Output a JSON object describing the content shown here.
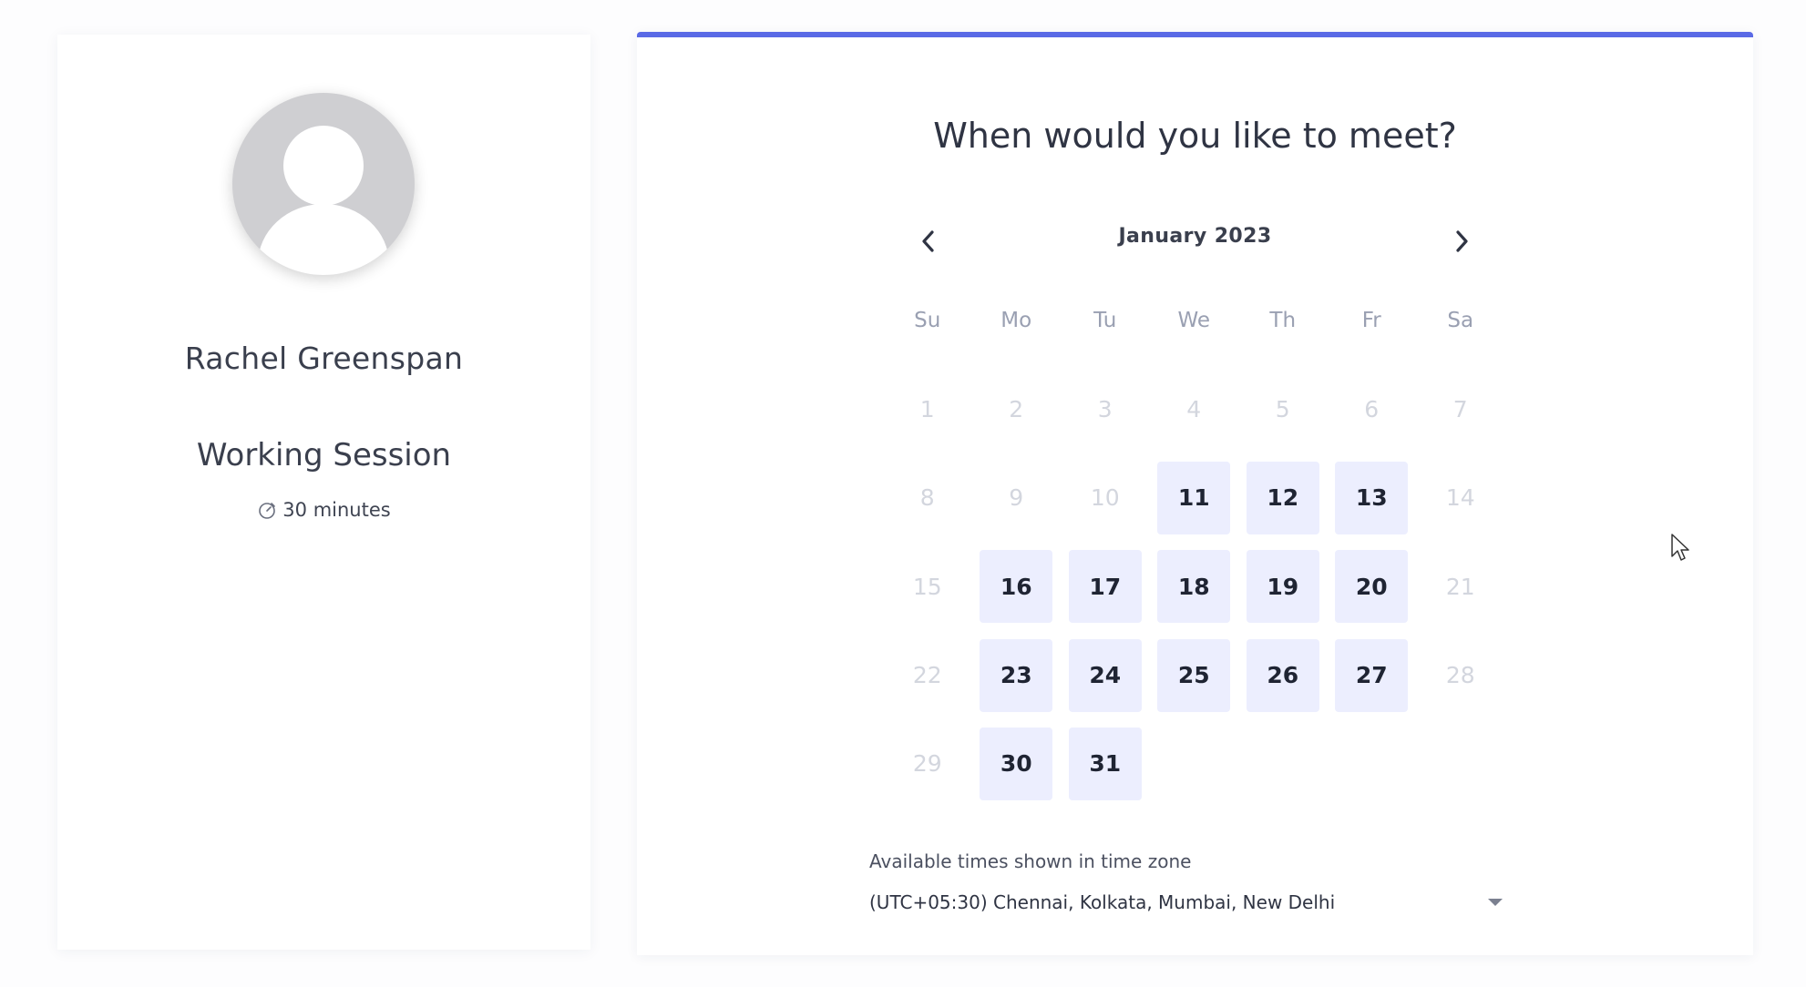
{
  "profile": {
    "name": "Rachel Greenspan",
    "event_name": "Working Session",
    "duration": "30 minutes",
    "duration_icon": "timer-icon"
  },
  "scheduler": {
    "heading": "When would you like to meet?",
    "month_label": "January 2023",
    "prev_icon": "chevron-left-icon",
    "next_icon": "chevron-right-icon",
    "accent_color": "#5a6ae6",
    "weekdays": [
      "Su",
      "Mo",
      "Tu",
      "We",
      "Th",
      "Fr",
      "Sa"
    ],
    "days": [
      {
        "label": "1",
        "available": false
      },
      {
        "label": "2",
        "available": false
      },
      {
        "label": "3",
        "available": false
      },
      {
        "label": "4",
        "available": false
      },
      {
        "label": "5",
        "available": false
      },
      {
        "label": "6",
        "available": false
      },
      {
        "label": "7",
        "available": false
      },
      {
        "label": "8",
        "available": false
      },
      {
        "label": "9",
        "available": false
      },
      {
        "label": "10",
        "available": false
      },
      {
        "label": "11",
        "available": true
      },
      {
        "label": "12",
        "available": true
      },
      {
        "label": "13",
        "available": true
      },
      {
        "label": "14",
        "available": false
      },
      {
        "label": "15",
        "available": false
      },
      {
        "label": "16",
        "available": true
      },
      {
        "label": "17",
        "available": true
      },
      {
        "label": "18",
        "available": true
      },
      {
        "label": "19",
        "available": true
      },
      {
        "label": "20",
        "available": true
      },
      {
        "label": "21",
        "available": false
      },
      {
        "label": "22",
        "available": false
      },
      {
        "label": "23",
        "available": true
      },
      {
        "label": "24",
        "available": true
      },
      {
        "label": "25",
        "available": true
      },
      {
        "label": "26",
        "available": true
      },
      {
        "label": "27",
        "available": true
      },
      {
        "label": "28",
        "available": false
      },
      {
        "label": "29",
        "available": false
      },
      {
        "label": "30",
        "available": true
      },
      {
        "label": "31",
        "available": true
      }
    ],
    "timezone_label": "Available times shown in time zone",
    "timezone_value": "(UTC+05:30) Chennai, Kolkata, Mumbai, New Delhi"
  }
}
